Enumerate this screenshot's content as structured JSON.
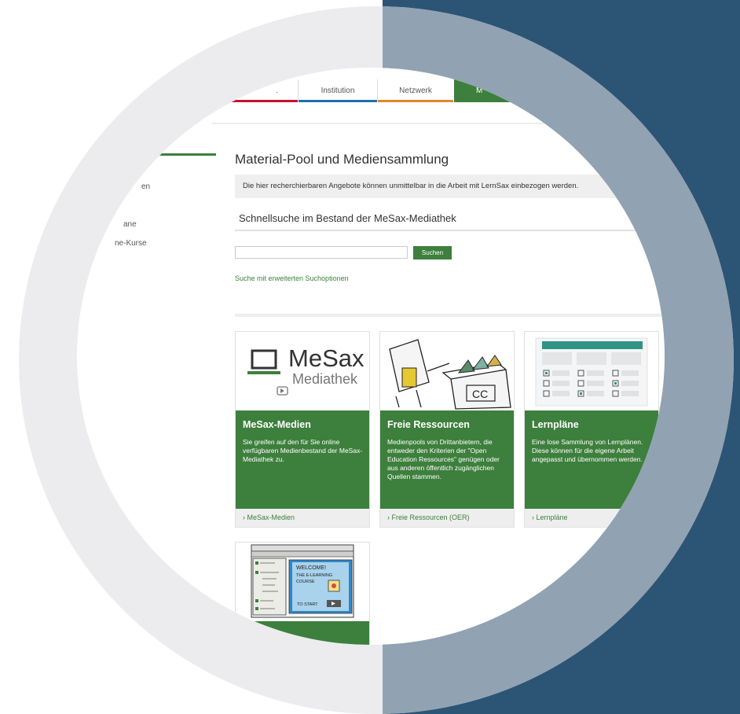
{
  "nav": {
    "tabs": [
      {
        "label": ".",
        "color": "#c8102e"
      },
      {
        "label": "Institution",
        "color": "#1f6fb2"
      },
      {
        "label": "Netzwerk",
        "color": "#e5852c"
      },
      {
        "label": "M",
        "color": "#3d7f3c"
      }
    ]
  },
  "sidebar": {
    "items": [
      "en",
      "ane",
      "ne-Kurse"
    ]
  },
  "main": {
    "title": "Material-Pool und Mediensammlung",
    "info_text": "Die hier recherchierbaren Angebote können unmittelbar in die Arbeit mit LernSax einbezogen werden.",
    "quicksearch_title": "Schnellsuche im Bestand der MeSax-Mediathek",
    "search": {
      "value": "",
      "placeholder": "",
      "button_label": "Suchen"
    },
    "advanced_link": "Suche mit erweiterten Suchoptionen"
  },
  "cards": [
    {
      "logo_name": "MeSax",
      "logo_sub": "Mediathek",
      "title": "MeSax-Medien",
      "description": "Sie greifen auf den für Sie online verfügbaren Medienbestand der MeSax-Mediathek zu.",
      "link": "› MeSax-Medien"
    },
    {
      "illustration_label": "CC",
      "title": "Freie Ressourcen",
      "description": "Medienpools von Drittanbietern, die entweder den Kriterien der \"Open Education Ressources\" genügen oder aus anderen öffentlich zugänglichen Quellen stammen.",
      "link": "› Freie Ressourcen (OER)"
    },
    {
      "title": "Lernpläne",
      "description": "Eine lose Sammlung von Lernplänen. Diese können für die eigene Arbeit angepasst und übernommen werden.",
      "link": "› Lernpläne"
    },
    {
      "sketch_lines": [
        "WELCOME!",
        "THE E-LEARNING",
        "COURSE",
        "TO START"
      ]
    }
  ],
  "colors": {
    "brand_green": "#3d7f3c",
    "bg_dark_blue": "#2c5475",
    "ring_light": "#ececee",
    "ring_blue_gray": "#91a2b2"
  }
}
